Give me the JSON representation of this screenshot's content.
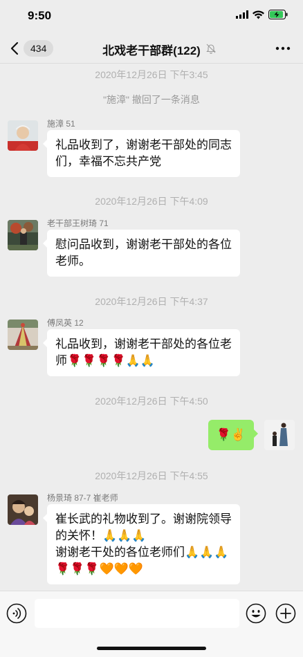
{
  "status_bar": {
    "time": "9:50"
  },
  "nav": {
    "back_count": "434",
    "title": "北戏老干部群(122)"
  },
  "messages": [
    {
      "type": "timestamp",
      "text": "2020年12月26日 下午3:45"
    },
    {
      "type": "system",
      "text": "\"施漳\" 撤回了一条消息"
    },
    {
      "type": "incoming",
      "sender": "施漳 51",
      "lines": [
        "礼品收到了，谢谢老干部处的同志",
        "们，幸福不忘共产党"
      ]
    },
    {
      "type": "timestamp",
      "text": "2020年12月26日 下午4:09"
    },
    {
      "type": "incoming",
      "sender": "老干部王树琦 71",
      "lines": [
        "慰问品收到，谢谢老干部处的各位",
        "老师。"
      ]
    },
    {
      "type": "timestamp",
      "text": "2020年12月26日 下午4:37"
    },
    {
      "type": "incoming",
      "sender": "傅凤英 12",
      "lines": [
        "礼品收到，谢谢老干部处的各位老",
        "师🌹🌹🌹🌹🙏🙏"
      ]
    },
    {
      "type": "timestamp",
      "text": "2020年12月26日 下午4:50"
    },
    {
      "type": "outgoing",
      "lines": [
        "🌹✌️"
      ]
    },
    {
      "type": "timestamp",
      "text": "2020年12月26日 下午4:55"
    },
    {
      "type": "incoming",
      "sender": "杨景琦 87-7 崔老师",
      "lines": [
        "崔长武的礼物收到了。谢谢院领导",
        "的关怀！🙏🙏🙏",
        "谢谢老干处的各位老师们🙏🙏🙏",
        "🌹🌹🌹🧡🧡🧡"
      ]
    }
  ],
  "input": {
    "placeholder": ""
  },
  "colors": {
    "self_bubble": "#95ec69",
    "bubble": "#ffffff",
    "background": "#ededed"
  }
}
